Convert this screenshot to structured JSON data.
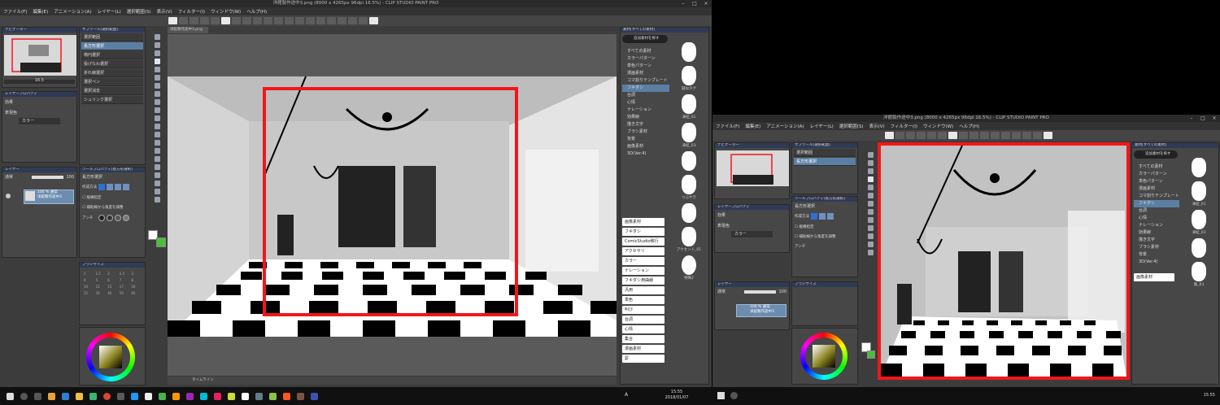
{
  "title": "洋館製作途中3.png (8000 x 4265px 96dpi 16.5%) - CLIP STUDIO PAINT PRO",
  "menu": [
    "ファイル(F)",
    "編集(E)",
    "アニメーション(A)",
    "レイヤー(L)",
    "選択範囲(S)",
    "表示(V)",
    "フィルター(I)",
    "ウィンドウ(W)",
    "ヘルプ(H)"
  ],
  "navigator_title": "ナビゲーター",
  "subtool_title": "サブツール[選択範囲]",
  "subtools": [
    "選択範囲",
    "長方形選択",
    "楕円選択",
    "投げなわ選択",
    "折れ線選択",
    "選択ペン",
    "選択消去",
    "シュリンク選択"
  ],
  "tool_property_title": "ツールプロパティ[長方形選択]",
  "tool_property_name": "長方形選択",
  "prop_mode_label": "作成方法",
  "prop_ratio": "縦横指定",
  "prop_center": "補助線から角度を調整",
  "prop_aa": "アンチ",
  "layer_prop_title": "レイヤープロパティ",
  "layer_prop_effect": "効果",
  "layer_prop_color": "表現色",
  "layer_prop_color_val": "カラー",
  "layer_title": "レイヤー",
  "layer_blend": "通常",
  "layer_opacity": "100",
  "layer_name_line1": "100 % 通常",
  "layer_name_line2": "洋館製作途中3",
  "brush_size_title": "ブラシサイズ",
  "canvas_tab": "洋館製作途中3.png",
  "material_title": "素材[すべての素材]",
  "material_search": "追加素材を探す",
  "material_tree": [
    "すべての素材",
    "カラーパターン",
    "単色パターン",
    "漫画素材",
    "コマ割りテンプレート",
    "フキダシ",
    "台詞",
    "心情",
    "ナレーション",
    "効果線",
    "描き文字",
    "ブラシ素材",
    "背景",
    "画像素材",
    "3D(Ver.4)"
  ],
  "material_tags": [
    "画像素材",
    "フキダシ",
    "ComicStudio移行",
    "アクセサリ",
    "カラー",
    "ナレーション",
    "フキダシ用曲線",
    "汎用",
    "単色",
    "叫び",
    "台詞",
    "心情",
    "集合",
    "漫画素材",
    "罫"
  ],
  "material_thumbs": [
    "",
    "疑似タグ",
    "凍結_01",
    "凍結_03",
    "",
    "つぶやき",
    "",
    "アクセント_01",
    "特殊2"
  ],
  "right_material_tree": [
    "すべての素材",
    "カラーパターン",
    "単色パターン",
    "漫画素材",
    "コマ割りテンプレート",
    "フキダシ",
    "台詞",
    "心情",
    "ナレーション",
    "効果線",
    "描き文字",
    "ブラシ素材",
    "背景",
    "3D(Ver.4)"
  ],
  "right_tag": "画像素材",
  "right_thumbs": [
    "",
    "凍結_01",
    "凍結_03",
    "",
    "集_03"
  ],
  "zoom_left": "16.5",
  "timeline_tab": "タイムライン",
  "clock_left": [
    "15:55",
    "2018/01/07"
  ],
  "clock_right": "15:55",
  "ime": "A",
  "colors": {
    "selection": "#f2161a",
    "main": "#ffffff",
    "sub": "#4cbd3b",
    "accent": "#5b7fa3"
  }
}
